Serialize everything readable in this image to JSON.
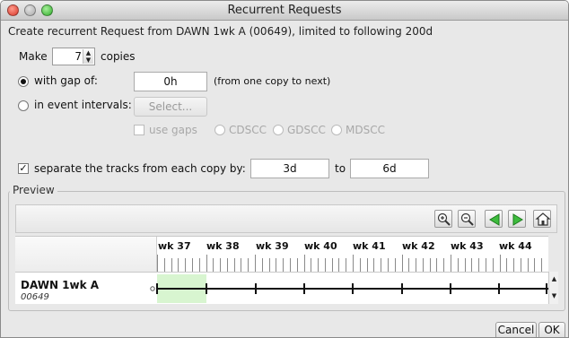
{
  "window": {
    "title": "Recurrent Requests"
  },
  "header_text": "Create recurrent Request from DAWN 1wk A (00649), limited to following 200d",
  "make": {
    "label": "Make",
    "count": "7",
    "suffix": "copies"
  },
  "gap": {
    "label": "with gap of:",
    "value": "0h",
    "hint": "(from one copy to next)",
    "selected": true
  },
  "event_intervals": {
    "label": "in event intervals:",
    "select_label": "Select...",
    "use_gaps_label": "use gaps",
    "options": [
      "CDSCC",
      "GDSCC",
      "MDSCC"
    ]
  },
  "separate": {
    "label": "separate the tracks from each copy by:",
    "checked": true,
    "from_value": "3d",
    "to_label": "to",
    "to_value": "6d"
  },
  "preview": {
    "title": "Preview",
    "toolbar_icons": [
      "zoom-in-icon",
      "zoom-out-icon",
      "back-arrow-icon",
      "forward-arrow-icon",
      "home-icon"
    ],
    "weeks": [
      "wk 37",
      "wk 38",
      "wk 39",
      "wk 40",
      "wk 41",
      "wk 42",
      "wk 43",
      "wk 44"
    ],
    "track": {
      "name": "DAWN 1wk A",
      "id": "00649"
    }
  },
  "buttons": {
    "cancel": "Cancel",
    "ok": "OK"
  },
  "colors": {
    "highlight_green": "#d8f5d0",
    "window_bg": "#e8e8e8"
  }
}
